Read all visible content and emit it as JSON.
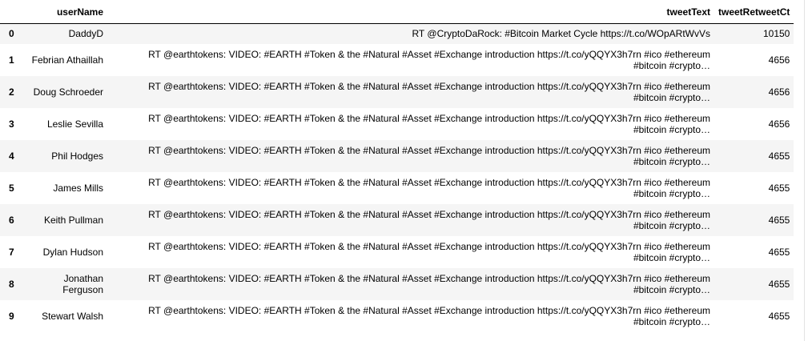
{
  "table": {
    "columns": {
      "index": "",
      "userName": "userName",
      "tweetText": "tweetText",
      "tweetRetweetCt": "tweetRetweetCt"
    },
    "rows": [
      {
        "index": "0",
        "userName": "DaddyD",
        "tweetText_line1": "RT @CryptoDaRock: #Bitcoin Market Cycle https://t.co/WOpARtWvVs",
        "tweetText_line2": "",
        "tweetRetweetCt": "10150"
      },
      {
        "index": "1",
        "userName": "Febrian Athaillah",
        "tweetText_line1": "RT @earthtokens: VIDEO: #EARTH #Token & the #Natural #Asset #Exchange introduction https://t.co/yQQYX3h7rn #ico #ethereum",
        "tweetText_line2": "#bitcoin #crypto…",
        "tweetRetweetCt": "4656"
      },
      {
        "index": "2",
        "userName": "Doug Schroeder",
        "tweetText_line1": "RT @earthtokens: VIDEO: #EARTH #Token & the #Natural #Asset #Exchange introduction https://t.co/yQQYX3h7rn #ico #ethereum",
        "tweetText_line2": "#bitcoin #crypto…",
        "tweetRetweetCt": "4656"
      },
      {
        "index": "3",
        "userName": "Leslie Sevilla",
        "tweetText_line1": "RT @earthtokens: VIDEO: #EARTH #Token & the #Natural #Asset #Exchange introduction https://t.co/yQQYX3h7rn #ico #ethereum",
        "tweetText_line2": "#bitcoin #crypto…",
        "tweetRetweetCt": "4656"
      },
      {
        "index": "4",
        "userName": "Phil Hodges",
        "tweetText_line1": "RT @earthtokens: VIDEO: #EARTH #Token & the #Natural #Asset #Exchange introduction https://t.co/yQQYX3h7rn #ico #ethereum",
        "tweetText_line2": "#bitcoin #crypto…",
        "tweetRetweetCt": "4655"
      },
      {
        "index": "5",
        "userName": "James Mills",
        "tweetText_line1": "RT @earthtokens: VIDEO: #EARTH #Token & the #Natural #Asset #Exchange introduction https://t.co/yQQYX3h7rn #ico #ethereum",
        "tweetText_line2": "#bitcoin #crypto…",
        "tweetRetweetCt": "4655"
      },
      {
        "index": "6",
        "userName": "Keith Pullman",
        "tweetText_line1": "RT @earthtokens: VIDEO: #EARTH #Token & the #Natural #Asset #Exchange introduction https://t.co/yQQYX3h7rn #ico #ethereum",
        "tweetText_line2": "#bitcoin #crypto…",
        "tweetRetweetCt": "4655"
      },
      {
        "index": "7",
        "userName": "Dylan Hudson",
        "tweetText_line1": "RT @earthtokens: VIDEO: #EARTH #Token & the #Natural #Asset #Exchange introduction https://t.co/yQQYX3h7rn #ico #ethereum",
        "tweetText_line2": "#bitcoin #crypto…",
        "tweetRetweetCt": "4655"
      },
      {
        "index": "8",
        "userName_line1": "Jonathan",
        "userName_line2": "Ferguson",
        "tweetText_line1": "RT @earthtokens: VIDEO: #EARTH #Token & the #Natural #Asset #Exchange introduction https://t.co/yQQYX3h7rn #ico #ethereum",
        "tweetText_line2": "#bitcoin #crypto…",
        "tweetRetweetCt": "4655"
      },
      {
        "index": "9",
        "userName": "Stewart Walsh",
        "tweetText_line1": "RT @earthtokens: VIDEO: #EARTH #Token & the #Natural #Asset #Exchange introduction https://t.co/yQQYX3h7rn #ico #ethereum",
        "tweetText_line2": "#bitcoin #crypto…",
        "tweetRetweetCt": "4655"
      }
    ]
  },
  "colors": {
    "stripe": "#f5f5f5",
    "header_rule": "#000000",
    "frame_rule": "#e3e3e3"
  }
}
